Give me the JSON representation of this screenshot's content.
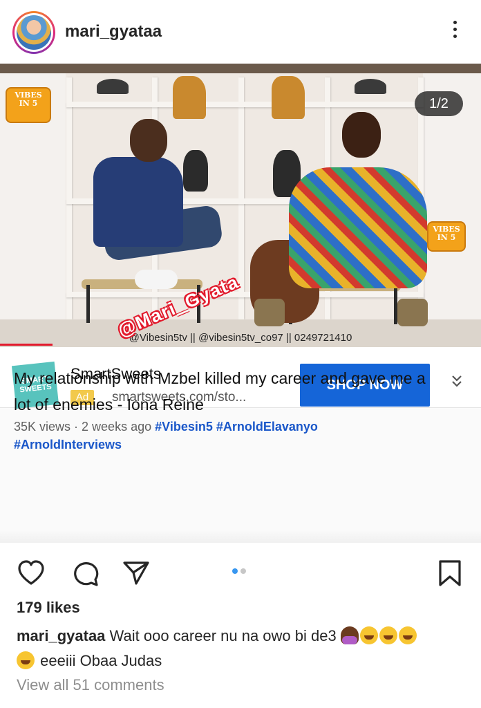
{
  "post": {
    "username": "mari_gyataa",
    "more_icon": "more-vertical-icon"
  },
  "media": {
    "counter": "1/2",
    "credit": "@Vibesin5tv || @vibesin5tv_co97 || 0249721410",
    "watermark": "@Mari_Gyata",
    "logo_text_1": "VIBES",
    "logo_text_2": "IN 5"
  },
  "ad": {
    "logo_text": "SMART SWEETS",
    "title": "SmartSweets",
    "badge": "Ad",
    "url": "smartsweets.com/sto...",
    "cta": "SHOP NOW"
  },
  "video": {
    "title": "My relationship with Mzbel killed my career and gave me a lot of enemies - Iona Reine",
    "views": "35K views · 2 weeks ago",
    "tags": [
      "#Vibesin5",
      "#ArnoldElavanyo",
      "#ArnoldInterviews"
    ]
  },
  "actions": {
    "carousel_total": 2,
    "carousel_active": 1
  },
  "likes": "179 likes",
  "caption": {
    "user": "mari_gyataa",
    "text_1": "Wait ooo career nu na owo bi de3",
    "text_2": "eeeiii Obaa Judas"
  },
  "comments_link": "View all 51 comments",
  "colors": {
    "accent_blue": "#1565d8",
    "tag_blue": "#1a57c9",
    "watermark_red": "#e21b2d"
  }
}
